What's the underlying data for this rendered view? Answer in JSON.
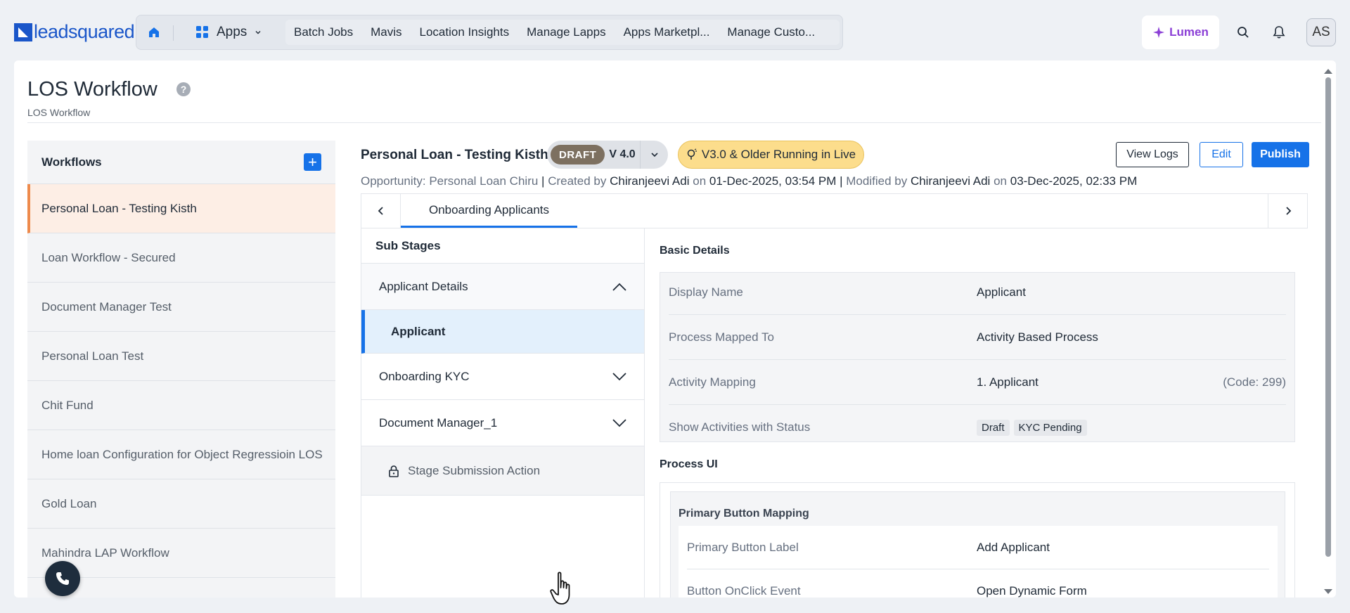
{
  "brand": {
    "logo_text": "leadsquared"
  },
  "nav": {
    "apps_label": "Apps",
    "links": [
      "Batch Jobs",
      "Mavis",
      "Location Insights",
      "Manage Lapps",
      "Apps Marketpl...",
      "Manage Custo..."
    ]
  },
  "topbar": {
    "lumen_label": "Lumen",
    "avatar_initials": "AS"
  },
  "page": {
    "title": "LOS Workflow",
    "breadcrumb": "LOS Workflow"
  },
  "sidebar": {
    "title": "Workflows",
    "items": [
      "Personal Loan - Testing Kisth",
      "Loan Workflow - Secured",
      "Document Manager Test",
      "Personal Loan Test",
      "Chit Fund",
      "Home loan Configuration for Object Regressioin LOS",
      "Gold Loan",
      "Mahindra LAP Workflow"
    ],
    "active_index": 0
  },
  "workflow": {
    "name": "Personal Loan - Testing Kisth",
    "status": "DRAFT",
    "version": "V 4.0",
    "live_notice": "V3.0 & Older Running in Live",
    "actions": {
      "view_logs": "View Logs",
      "edit": "Edit",
      "publish": "Publish"
    },
    "meta": {
      "opportunity_label": "Opportunity: Personal Loan Chiru",
      "created_by_label": "Created by",
      "created_by": "Chiranjeevi Adi",
      "on": "on",
      "created_on": "01-Dec-2025, 03:54 PM",
      "modified_by_label": "Modified by",
      "modified_by": "Chiranjeevi Adi",
      "modified_on": "03-Dec-2025, 02:33 PM"
    }
  },
  "stage": {
    "active_tab": "Onboarding Applicants"
  },
  "substages": {
    "title": "Sub Stages",
    "groups": [
      {
        "label": "Applicant Details",
        "expanded": true,
        "children": [
          "Applicant"
        ]
      },
      {
        "label": "Onboarding KYC",
        "expanded": false
      },
      {
        "label": "Document Manager_1",
        "expanded": false
      }
    ],
    "submission_action": "Stage Submission Action"
  },
  "basic_details": {
    "title": "Basic Details",
    "rows": [
      {
        "key": "Display Name",
        "value": "Applicant"
      },
      {
        "key": "Process Mapped To",
        "value": "Activity Based Process"
      },
      {
        "key": "Activity Mapping",
        "value": "1. Applicant",
        "code": "(Code: 299)"
      },
      {
        "key": "Show Activities with Status",
        "tags": [
          "Draft",
          "KYC Pending"
        ]
      }
    ]
  },
  "process_ui": {
    "title": "Process UI",
    "primary_button_mapping": {
      "title": "Primary Button Mapping",
      "rows": [
        {
          "key": "Primary Button Label",
          "value": "Add Applicant"
        },
        {
          "key": "Button OnClick Event",
          "value": "Open Dynamic Form"
        }
      ]
    }
  },
  "colors": {
    "primary": "#1672e8",
    "draft_badge": "#7d7060",
    "live_notice": "#fcdd8c",
    "active_sidebar": "#fdeee5",
    "active_sidebar_border": "#ee8a4c",
    "lumen": "#8b3fd6"
  }
}
